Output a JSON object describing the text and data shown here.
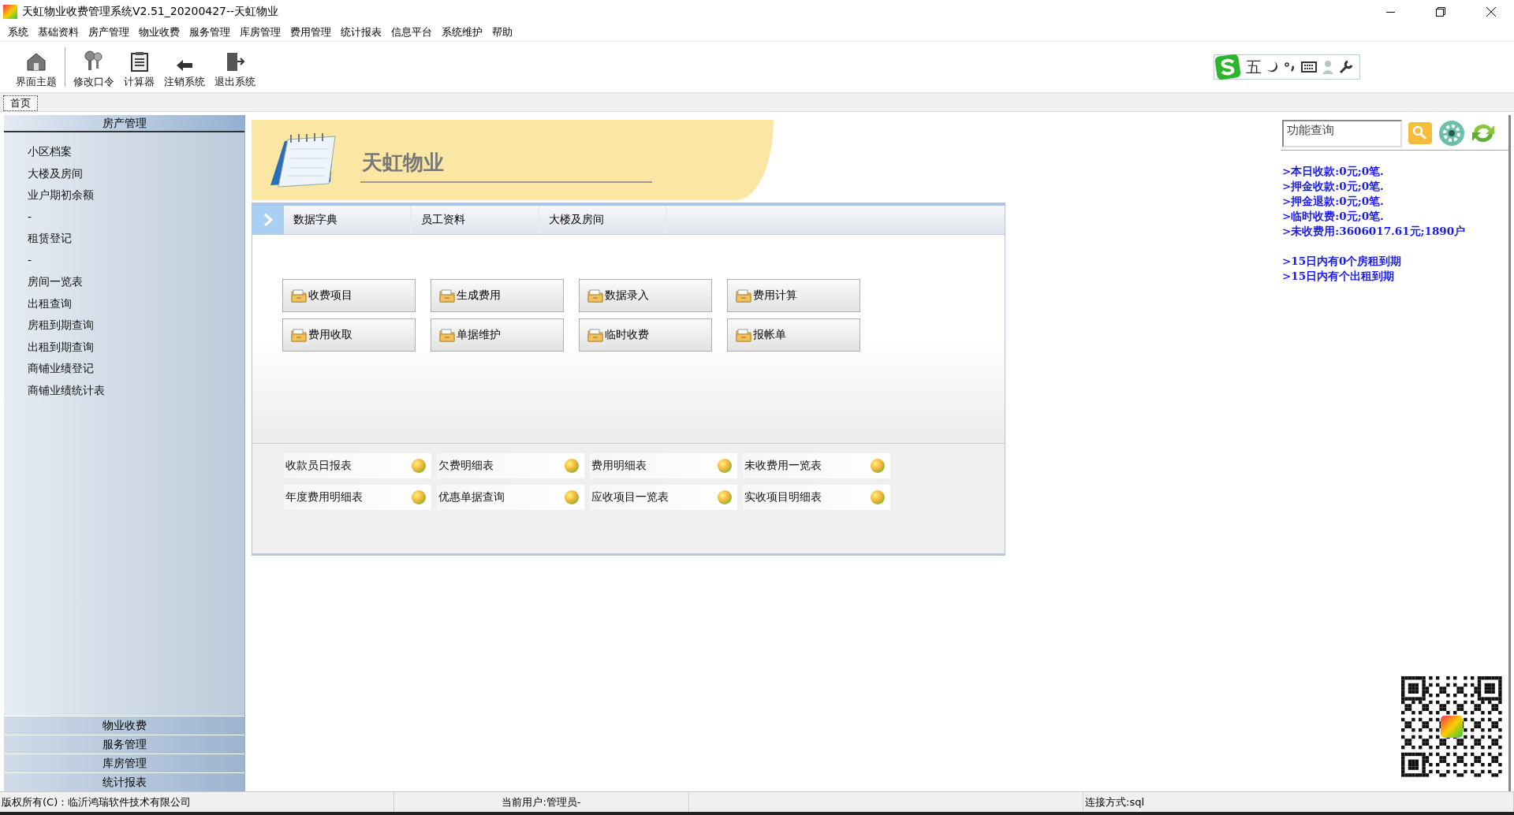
{
  "window": {
    "title": "天虹物业收费管理系统V2.51_20200427--天虹物业"
  },
  "menu": [
    "系统",
    "基础资料",
    "房产管理",
    "物业收费",
    "服务管理",
    "库房管理",
    "费用管理",
    "统计报表",
    "信息平台",
    "系统维护",
    "帮助"
  ],
  "toolbar": [
    {
      "kind": "theme",
      "label": "界面主题"
    },
    {
      "kind": "keys",
      "label": "修改口令"
    },
    {
      "kind": "calculator",
      "label": "计算器"
    },
    {
      "kind": "logout",
      "label": "注销系统"
    },
    {
      "kind": "exit",
      "label": "退出系统"
    }
  ],
  "ime": {
    "mode": "五"
  },
  "tabs": [
    {
      "label": "首页",
      "selected": true
    }
  ],
  "sidebar": {
    "header": "房产管理",
    "items": [
      "小区档案",
      "大楼及房间",
      "业户期初余额",
      "-",
      "租赁登记",
      "-",
      "房间一览表",
      "出租查询",
      "房租到期查询",
      "出租到期查询",
      "商铺业绩登记",
      "商铺业绩统计表"
    ],
    "sections": [
      "物业收费",
      "服务管理",
      "库房管理",
      "统计报表"
    ]
  },
  "banner": {
    "title": "天虹物业"
  },
  "nav_tabs": [
    "数据字典",
    "员工资料",
    "大楼及房间"
  ],
  "action_buttons": [
    "收费项目",
    "生成费用",
    "数据录入",
    "费用计算",
    "费用收取",
    "单据维护",
    "临时收费",
    "报帐单"
  ],
  "reports": [
    "收款员日报表",
    "欠费明细表",
    "费用明细表",
    "未收费用一览表",
    "年度费用明细表",
    "优惠单据查询",
    "应收项目一览表",
    "实收项目明细表"
  ],
  "search": {
    "placeholder": "功能查询"
  },
  "stats": [
    ">本日收款:0元;0笔.",
    ">押金收款:0元;0笔.",
    ">押金退款:0元;0笔.",
    ">临时收费:0元;0笔.",
    ">未收费用:3606017.61元;1890户"
  ],
  "notices": [
    ">15日内有0个房租到期",
    ">15日内有个出租到期"
  ],
  "status_bar": {
    "copyright": "版权所有(C)：临沂鸿瑞软件技术有限公司",
    "user": "当前用户:管理员-",
    "connection": "连接方式:sql"
  }
}
